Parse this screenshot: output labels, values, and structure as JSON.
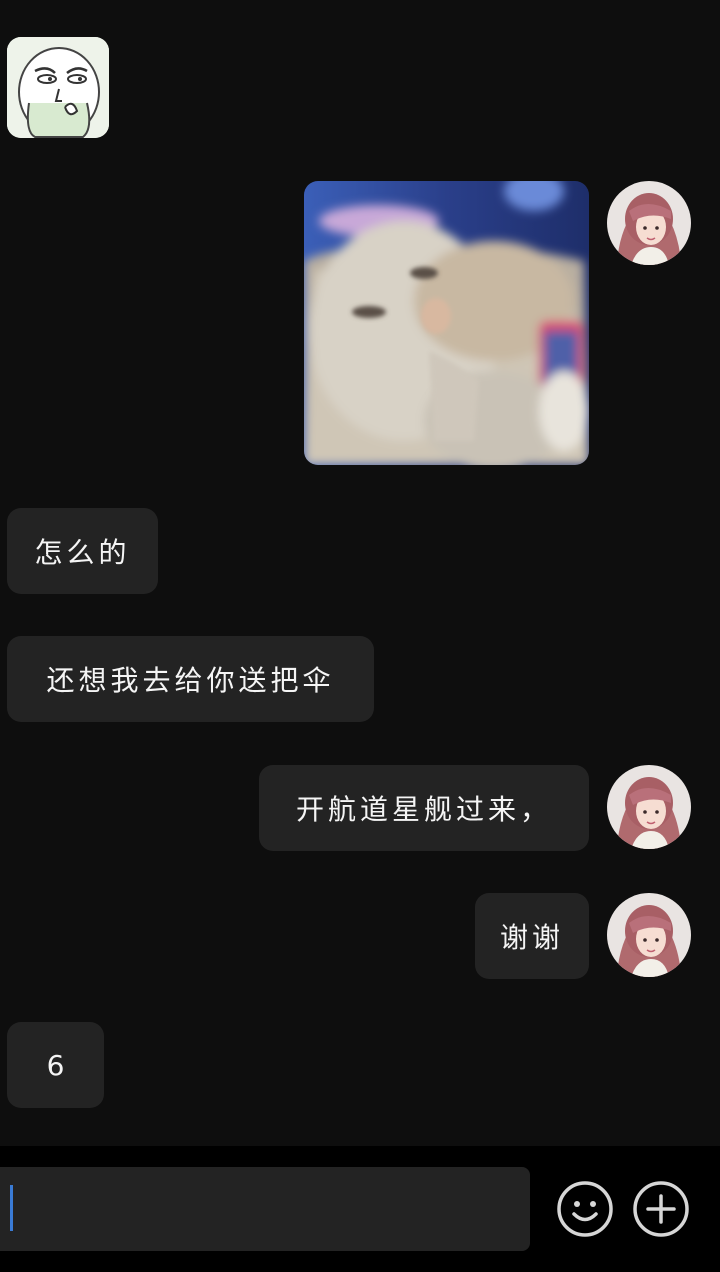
{
  "messages": [
    {
      "side": "left",
      "type": "sticker",
      "sticker": "face-meme-sticker"
    },
    {
      "side": "right",
      "type": "image",
      "image": "cat-photo"
    },
    {
      "side": "left",
      "type": "text",
      "text": "怎么的"
    },
    {
      "side": "left",
      "type": "text",
      "text": "还想我去给你送把伞"
    },
    {
      "side": "right",
      "type": "text",
      "text": "开航道星舰过来，"
    },
    {
      "side": "right",
      "type": "text",
      "text": "谢谢"
    },
    {
      "side": "left",
      "type": "text",
      "text": "6"
    }
  ],
  "input": {
    "value": "",
    "placeholder": ""
  },
  "icons": {
    "emoji": "smiley-icon",
    "add": "plus-circle-icon"
  },
  "colors": {
    "background": "#0e0e0e",
    "bubble": "#232323",
    "caret": "#3a7bd5"
  }
}
